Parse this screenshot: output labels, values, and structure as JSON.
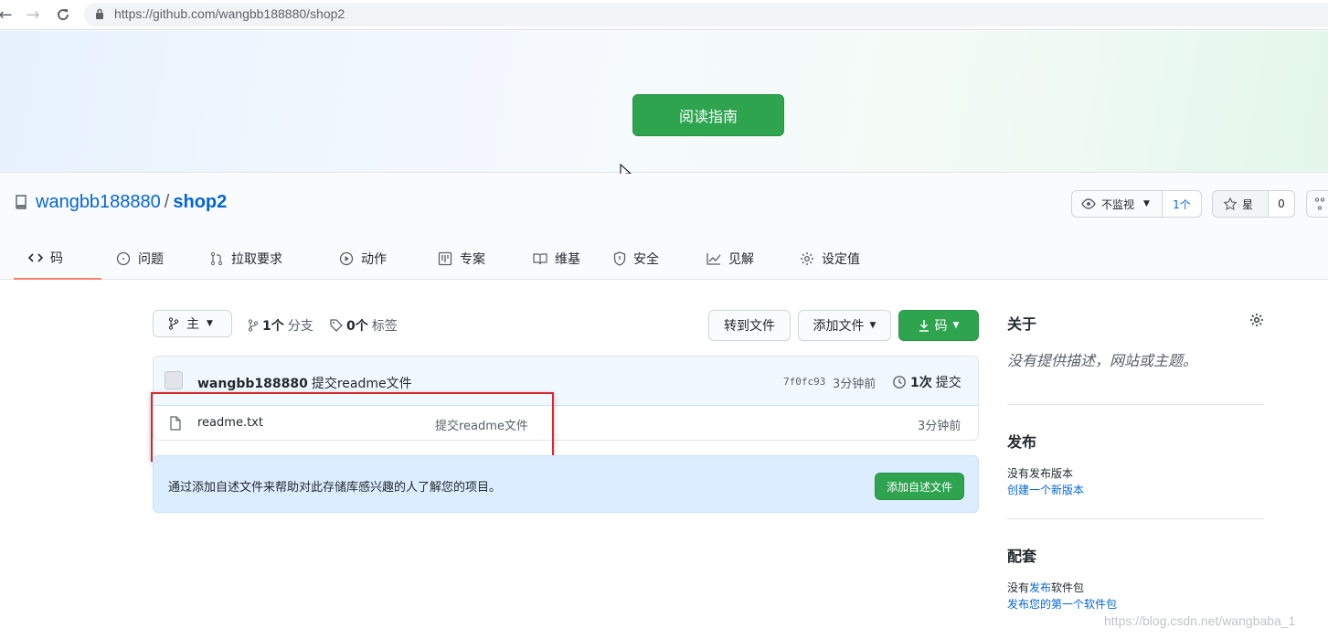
{
  "browser": {
    "url_host": "https://github.com/",
    "url_path": "wangbb188880/shop2"
  },
  "banner": {
    "guide_button": "阅读指南"
  },
  "repo": {
    "owner": "wangbb188880",
    "separator": "/",
    "name": "shop2",
    "watch_label": "不监视",
    "watch_count": "1个",
    "star_label": "星",
    "star_count": "0"
  },
  "tabs": [
    {
      "label": "码",
      "icon": "code-icon"
    },
    {
      "label": "问题",
      "icon": "issue-icon"
    },
    {
      "label": "拉取要求",
      "icon": "pull-request-icon"
    },
    {
      "label": "动作",
      "icon": "play-icon"
    },
    {
      "label": "专案",
      "icon": "project-icon"
    },
    {
      "label": "维基",
      "icon": "book-icon"
    },
    {
      "label": "安全",
      "icon": "shield-icon"
    },
    {
      "label": "见解",
      "icon": "graph-icon"
    },
    {
      "label": "设定值",
      "icon": "gear-icon"
    }
  ],
  "toolbar": {
    "branch": "主",
    "branch_count": "1个",
    "branch_label": "分支",
    "tag_count": "0个",
    "tag_label": "标签",
    "goto_file": "转到文件",
    "add_file": "添加文件",
    "code": "码"
  },
  "commit": {
    "author": "wangbb188880",
    "message": "提交readme文件",
    "sha": "7f0fc93",
    "ago": "3分钟前",
    "count": "1次",
    "count_label": "提交"
  },
  "files": [
    {
      "name": "readme.txt",
      "message": "提交readme文件",
      "ago": "3分钟前"
    }
  ],
  "readme_prompt": {
    "text": "通过添加自述文件来帮助对此存储库感兴趣的人了解您的项目。",
    "button": "添加自述文件"
  },
  "sidebar": {
    "about_title": "关于",
    "about_desc": "没有提供描述，网站或主题。",
    "releases_title": "发布",
    "releases_none": "没有发布版本",
    "releases_link": "创建一个新版本",
    "packages_title": "配套",
    "packages_none_prefix": "没有",
    "packages_none_link": "发布",
    "packages_none_suffix": "软件包",
    "packages_link": "发布您的第一个软件包"
  },
  "watermark": "https://blog.csdn.net/wangbaba_1"
}
